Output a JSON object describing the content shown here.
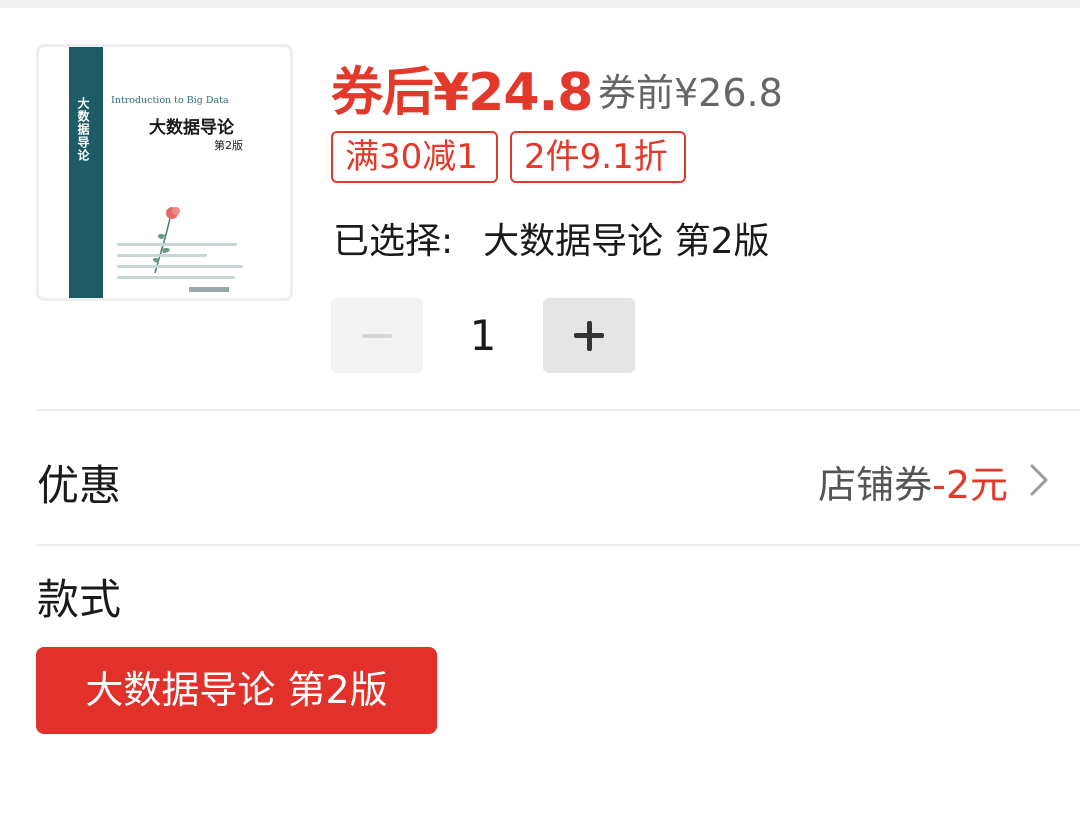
{
  "product": {
    "image_title": "大数据导论",
    "image_edition": "第2版",
    "image_english": "Introduction to Big Data",
    "spine_text": "大数据导论"
  },
  "price": {
    "after_coupon": "券后¥24.8",
    "before_coupon": "券前¥26.8"
  },
  "promo_tags": [
    "满30减1",
    "2件9.1折"
  ],
  "selection": {
    "label": "已选择:",
    "value": "大数据导论 第2版"
  },
  "quantity": {
    "value": "1"
  },
  "discount_row": {
    "label": "优惠",
    "value_grey": "店铺券",
    "value_red": "-2元"
  },
  "style_row": {
    "label": "款式",
    "options": [
      "大数据导论 第2版"
    ]
  },
  "colors": {
    "accent_red": "#e2392b",
    "chip_red": "#e2302b",
    "book_teal": "#1d5b66"
  }
}
